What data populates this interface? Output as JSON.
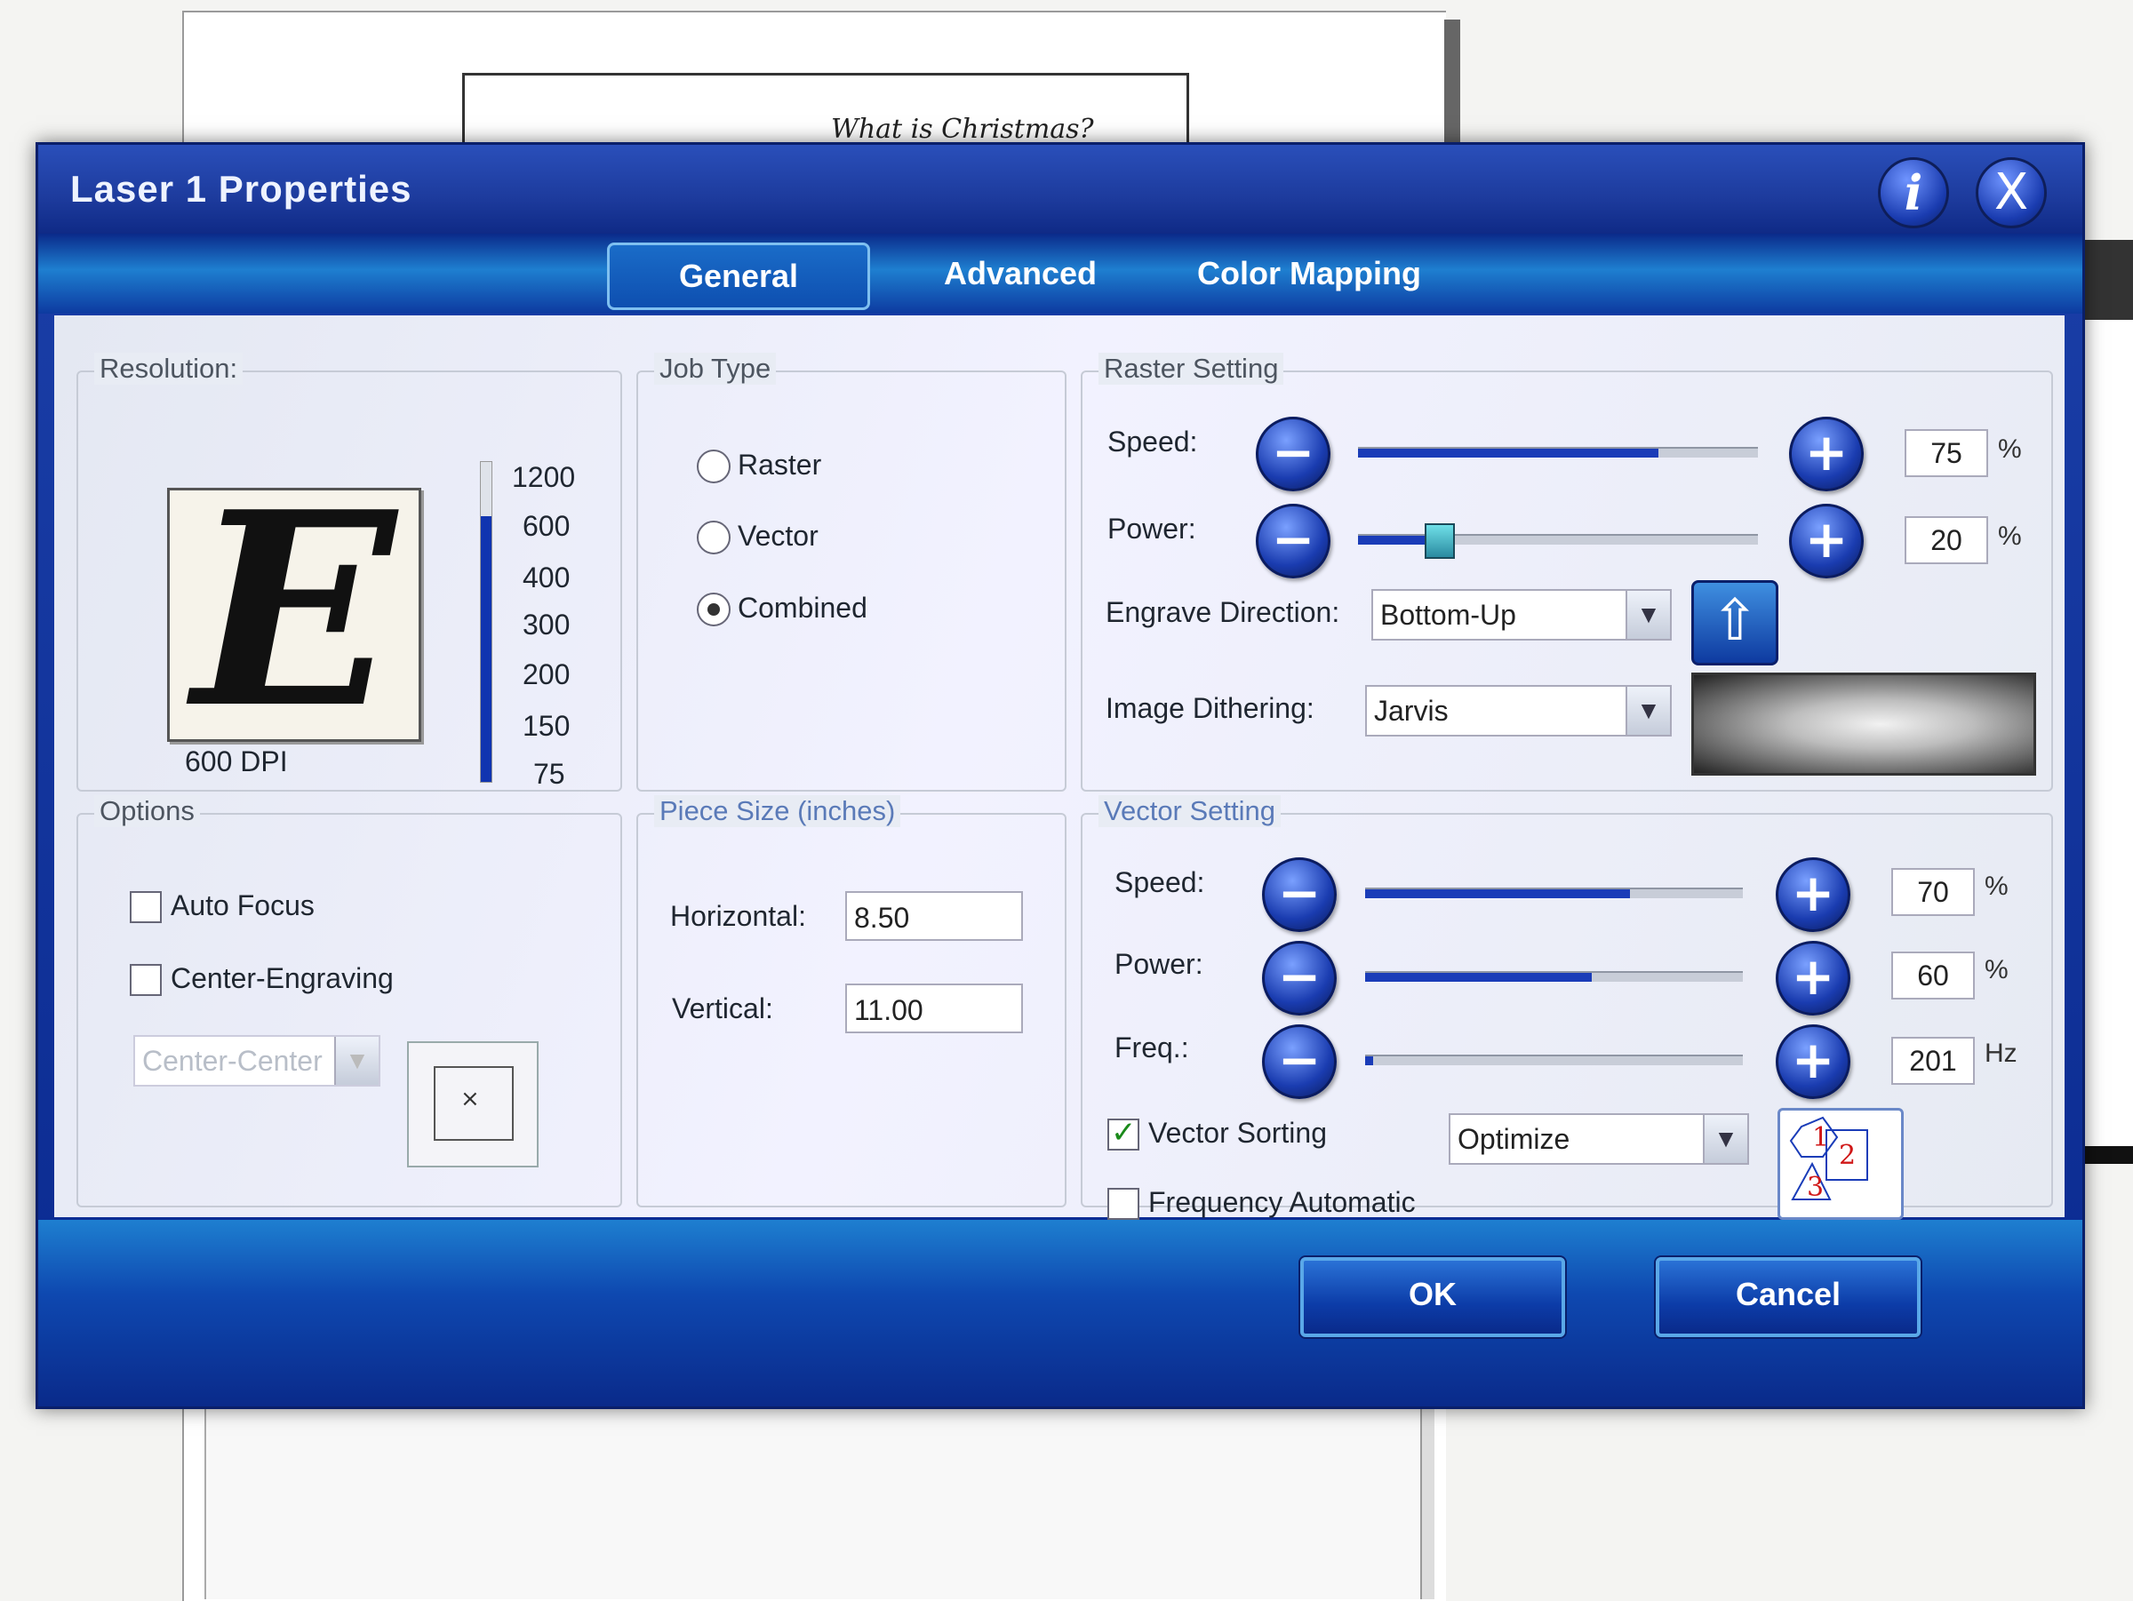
{
  "background": {
    "document_title": "What is Christmas?"
  },
  "dialog": {
    "title": "Laser 1 Properties",
    "info_icon": "i",
    "close_icon": "X",
    "tabs": [
      {
        "label": "General",
        "active": true
      },
      {
        "label": "Advanced",
        "active": false
      },
      {
        "label": "Color Mapping",
        "active": false
      }
    ]
  },
  "resolution": {
    "label": "Resolution:",
    "preview_letter": "E",
    "dpi_text": "600 DPI",
    "ticks": [
      "1200",
      "600",
      "400",
      "300",
      "200",
      "150",
      "75"
    ],
    "level_fraction": 0.83
  },
  "job_type": {
    "label": "Job Type",
    "options": [
      {
        "label": "Raster",
        "selected": false
      },
      {
        "label": "Vector",
        "selected": false
      },
      {
        "label": "Combined",
        "selected": true
      }
    ]
  },
  "raster": {
    "label": "Raster Setting",
    "speed": {
      "label": "Speed:",
      "value": "75",
      "unit": "%",
      "fraction": 0.75
    },
    "power": {
      "label": "Power:",
      "value": "20",
      "unit": "%",
      "fraction": 0.2
    },
    "engrave_direction": {
      "label": "Engrave Direction:",
      "value": "Bottom-Up"
    },
    "image_dithering": {
      "label": "Image Dithering:",
      "value": "Jarvis"
    }
  },
  "options": {
    "label": "Options",
    "auto_focus": {
      "label": "Auto Focus",
      "checked": false
    },
    "center_engraving": {
      "label": "Center-Engraving",
      "checked": false
    },
    "center_select": {
      "value": "Center-Center"
    }
  },
  "piece_size": {
    "label": "Piece Size (inches)",
    "horizontal": {
      "label": "Horizontal:",
      "value": "8.50"
    },
    "vertical": {
      "label": "Vertical:",
      "value": "11.00"
    }
  },
  "vector": {
    "label": "Vector Setting",
    "speed": {
      "label": "Speed:",
      "value": "70",
      "unit": "%",
      "fraction": 0.7
    },
    "power": {
      "label": "Power:",
      "value": "60",
      "unit": "%",
      "fraction": 0.6
    },
    "freq": {
      "label": "Freq.:",
      "value": "201",
      "unit": "Hz",
      "fraction": 0.02
    },
    "vector_sorting": {
      "label": "Vector Sorting",
      "checked": true,
      "option": "Optimize"
    },
    "frequency_automatic": {
      "label": "Frequency Automatic",
      "checked": false
    },
    "sort_icon_digits": [
      "1",
      "2",
      "3"
    ]
  },
  "buttons": {
    "ok": "OK",
    "cancel": "Cancel"
  },
  "colors": {
    "accent": "#1a3cb8",
    "title_bg": "#1d3b9d",
    "tab_active_border": "#7fc0f0"
  }
}
